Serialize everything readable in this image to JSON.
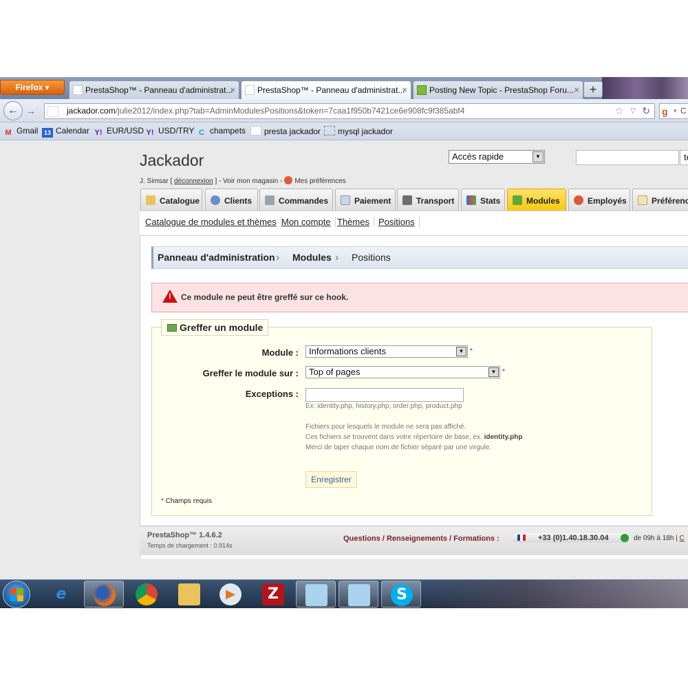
{
  "browser": {
    "menu_button": "Firefox",
    "tabs": [
      {
        "title": "PrestaShop™ - Panneau d'administrat...",
        "close": "×"
      },
      {
        "title": "PrestaShop™ - Panneau d'administrat...",
        "close": "×"
      },
      {
        "title": "Posting New Topic - PrestaShop Foru...",
        "close": "×"
      }
    ],
    "new_tab": "+",
    "url_host": "jackador.com",
    "url_path": "/julie2012/index.php?tab=AdminModulesPositions&token=7caa1f950b7421ce6e908fc9f385abf4",
    "search_letter": "C",
    "bookmarks": [
      "Gmail",
      "Calendar",
      "EUR/USD",
      "USD/TRY",
      "champets",
      "presta jackador",
      "mysql jackador"
    ],
    "calendar_badge": "13"
  },
  "header": {
    "site_title": "Jackador",
    "user": "J. Simsar [",
    "logout": "déconnexion",
    "user_after": "] - Voir mon magasin -",
    "preferences": "Mes préférences",
    "quick_access": "Accès rapide",
    "search_button": "te"
  },
  "menu_tabs": [
    "Catalogue",
    "Clients",
    "Commandes",
    "Paiement",
    "Transport",
    "Stats",
    "Modules",
    "Employés",
    "Préférenc"
  ],
  "submenu": [
    "Catalogue de modules et thèmes",
    "Mon compte",
    "Thèmes",
    "Positions"
  ],
  "breadcrumb": [
    "Panneau d'administration",
    "Modules",
    "Positions"
  ],
  "error": "Ce module ne peut être greffé sur ce hook.",
  "form": {
    "legend": "Greffer un module",
    "module_label": "Module :",
    "module_value": "Informations clients",
    "hook_label": "Greffer le module sur :",
    "hook_value": "Top of pages",
    "exceptions_label": "Exceptions :",
    "exceptions_example": "Ex: identity.php, history.php, order.php, product.php",
    "help_1": "Fichiers pour lesquels le module ne sera pas affiché.",
    "help_2_prefix": "Ces fichiers se trouvent dans votre répertoire de base, ex.",
    "help_2_file": "identity.php",
    "help_3": "Merci de taper chaque nom de fichier séparé par une virgule.",
    "save": "Enregistrer",
    "required_star": "*",
    "required_note": "Champs requis"
  },
  "footer": {
    "version": "PrestaShop™ 1.4.6.2",
    "load_time": "Temps de chargement : 0.914s",
    "questions": "Questions / Renseignements / Formations :",
    "phone": "+33 (0)1.40.18.30.04",
    "hours": "de 09h à 18h |",
    "hours_link": "C"
  }
}
